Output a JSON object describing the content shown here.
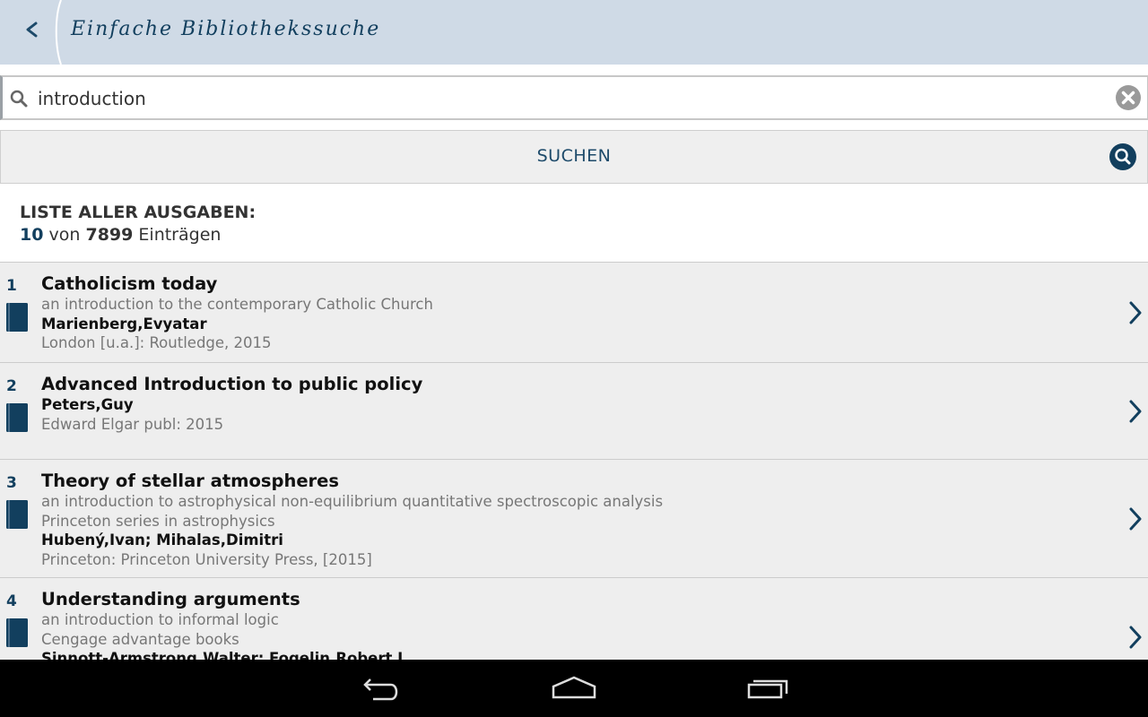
{
  "header": {
    "title": "Einfache Bibliothekssuche",
    "back_icon": "chevron-left-icon"
  },
  "search": {
    "value": "introduction",
    "button_label": "SUCHEN"
  },
  "summary": {
    "title": "LISTE ALLER AUSGABEN:",
    "shown": "10",
    "between": "von",
    "total": "7899",
    "suffix": "Einträgen"
  },
  "results": [
    {
      "rank": "1",
      "title": "Catholicism today",
      "subtitle": "an introduction to the contemporary Catholic Church",
      "series": "",
      "author": "Marienberg,Evyatar",
      "publisher": "London [u.a.]: Routledge, 2015"
    },
    {
      "rank": "2",
      "title": "Advanced Introduction to public policy",
      "subtitle": "",
      "series": "",
      "author": "Peters,Guy",
      "publisher": "Edward Elgar publ: 2015"
    },
    {
      "rank": "3",
      "title": "Theory of stellar atmospheres",
      "subtitle": "an introduction to astrophysical non-equilibrium quantitative spectroscopic analysis",
      "series": "Princeton series in astrophysics",
      "author": "Hubený,Ivan; Mihalas,Dimitri",
      "publisher": "Princeton: Princeton University Press, [2015]"
    },
    {
      "rank": "4",
      "title": "Understanding arguments",
      "subtitle": "an introduction to informal logic",
      "series": "Cengage advantage books",
      "author": "Sinnott-Armstrong,Walter; Fogelin,Robert J.",
      "publisher": ""
    }
  ],
  "colors": {
    "accent": "#123f5e",
    "header_bg": "#cfdae6",
    "row_bg": "#eeeeee"
  }
}
